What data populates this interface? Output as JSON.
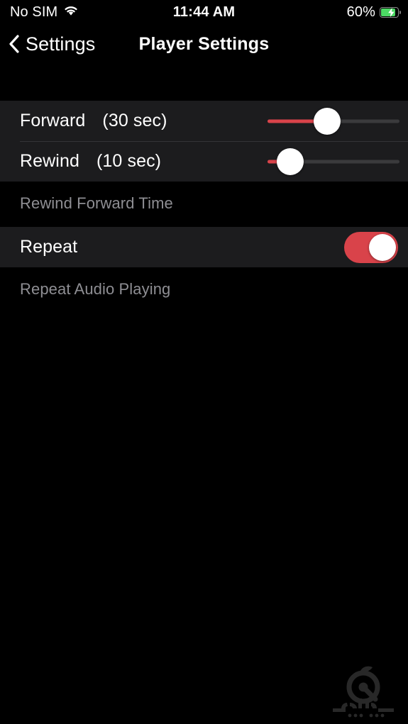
{
  "status_bar": {
    "carrier": "No SIM",
    "wifi_icon": "wifi-icon",
    "time": "11:44 AM",
    "battery_percent": "60%",
    "battery_icon": "battery-charging-icon",
    "battery_color": "#4CD964"
  },
  "nav_bar": {
    "back_icon": "chevron-left-icon",
    "back_label": "Settings",
    "title": "Player Settings"
  },
  "accent_color": "#D9434A",
  "sections": [
    {
      "rows": [
        {
          "name": "forward",
          "label": "Forward",
          "value": "(30 sec)",
          "control": "slider",
          "slider_percent": 45
        },
        {
          "name": "rewind",
          "label": "Rewind",
          "value": "(10 sec)",
          "control": "slider",
          "slider_percent": 17
        }
      ],
      "caption": "Rewind Forward Time"
    },
    {
      "rows": [
        {
          "name": "repeat",
          "label": "Repeat",
          "value": "",
          "control": "toggle",
          "toggle_on": "on"
        }
      ],
      "caption": "Repeat Audio Playing"
    }
  ],
  "watermark": {
    "name": "sibapp-logo-watermark",
    "text": "سیب اپ"
  }
}
